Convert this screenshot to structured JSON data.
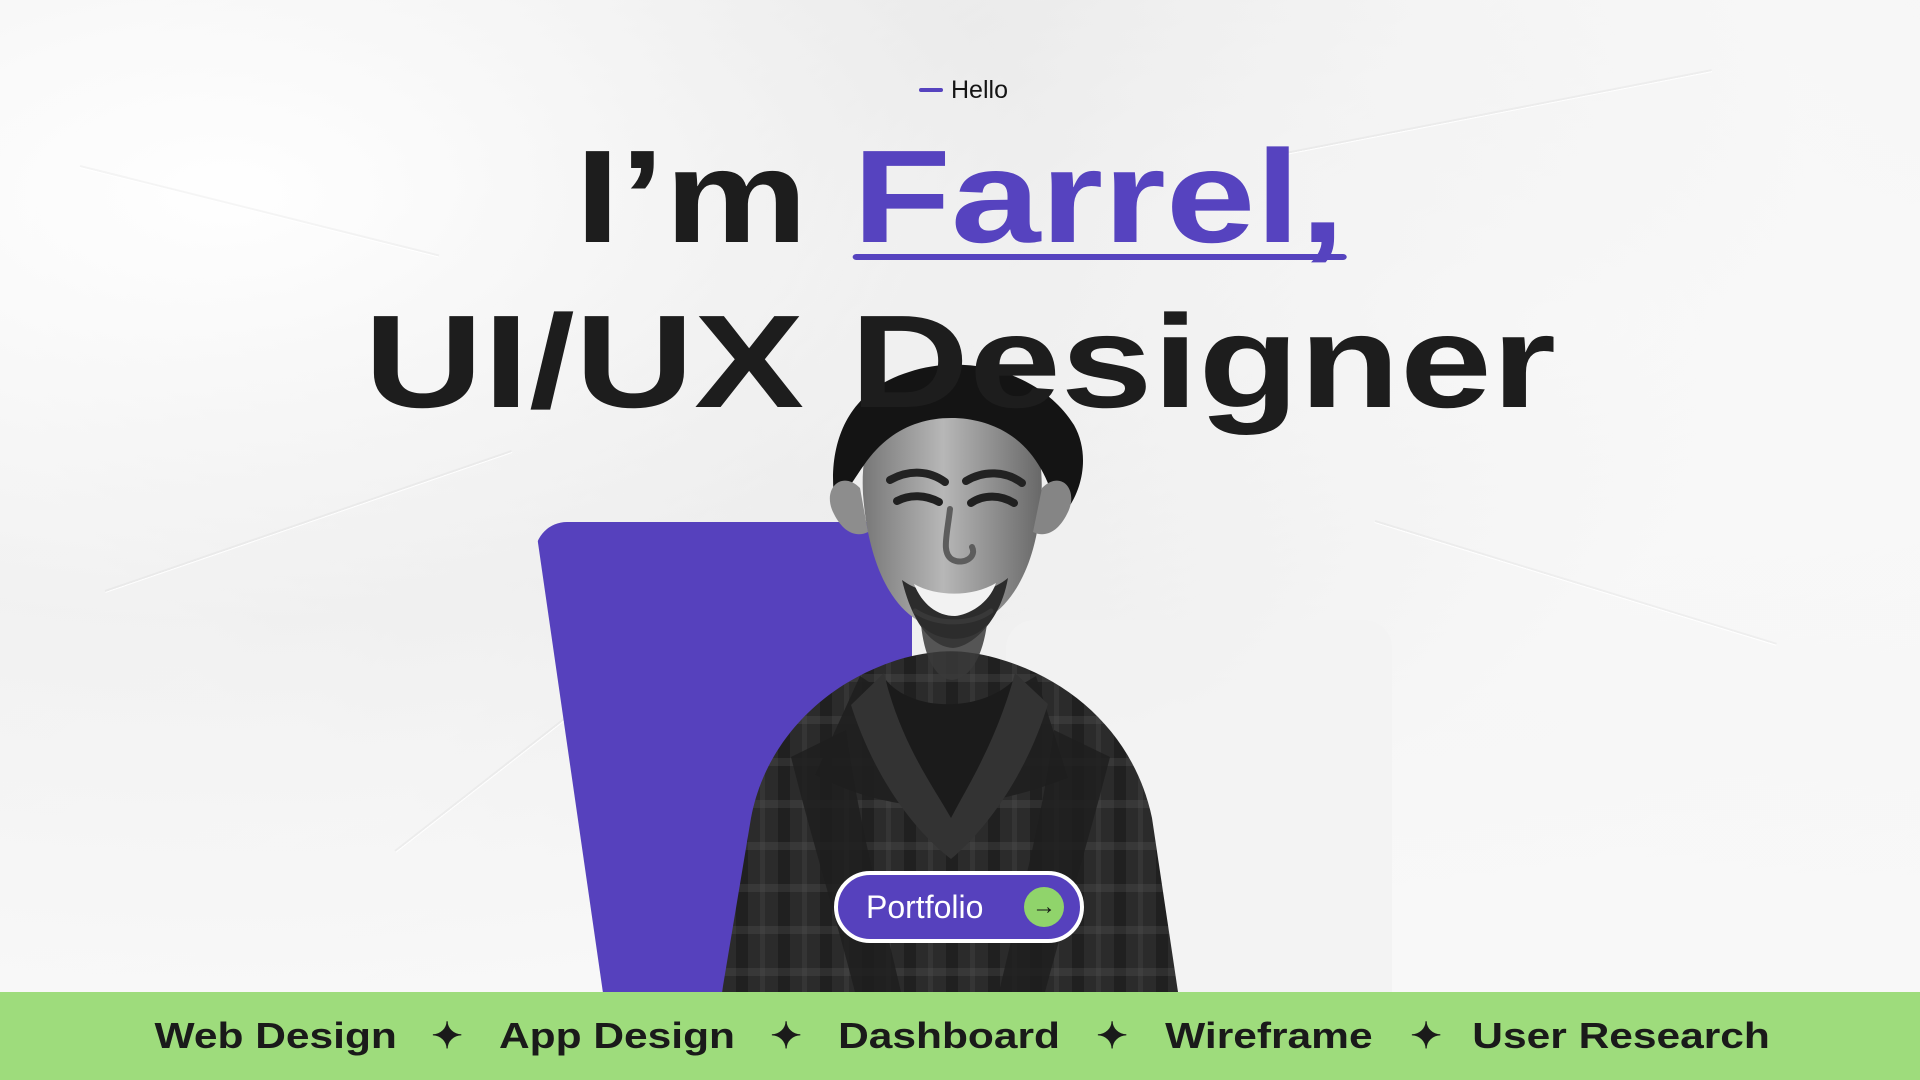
{
  "hero": {
    "eyebrow": "Hello",
    "intro": "I’m ",
    "name": "Farrel,",
    "role": "UI/UX Designer"
  },
  "button": {
    "label": "Portfolio",
    "icon": "arrow-right-icon",
    "arrow": "→"
  },
  "ticker": {
    "items": [
      "Web Design",
      "App Design",
      "Dashboard",
      "Wireframe",
      "User Research"
    ],
    "separator_icon": "four-point-star-icon",
    "separator": "✦"
  },
  "colors": {
    "accent": "#5641BD",
    "green": "#9EDC7C",
    "text": "#1D1D1D"
  }
}
